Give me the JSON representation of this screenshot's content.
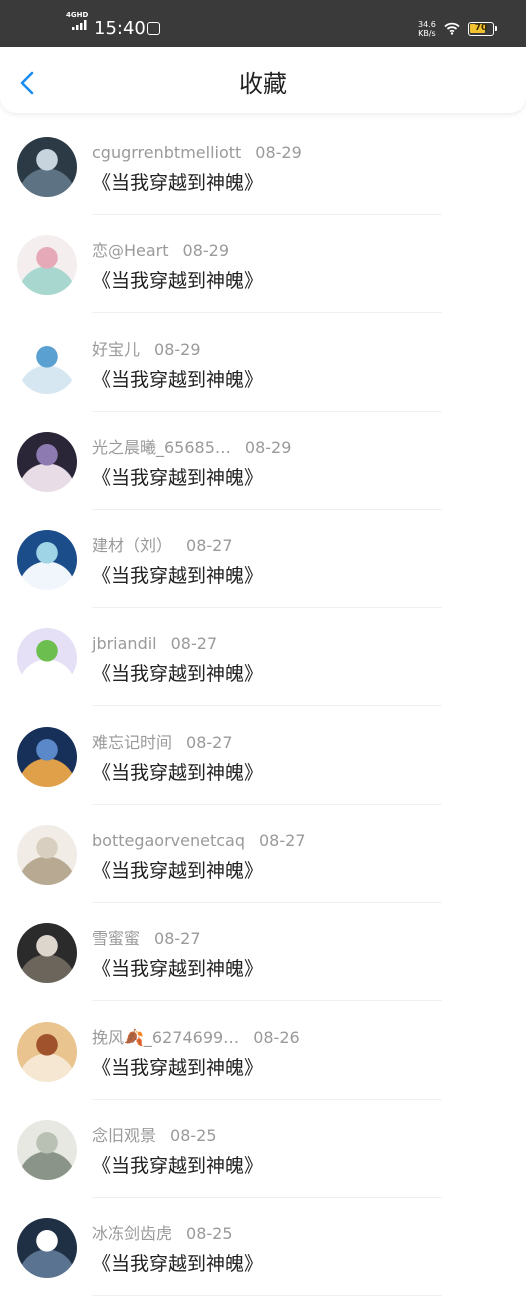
{
  "status_bar": {
    "network": "4GHD",
    "time": "15:40",
    "speed_value": "34.6",
    "speed_unit": "KB/s",
    "battery_level": 70,
    "battery_text": "70",
    "icons": [
      "signal-icon",
      "app-notification-icon",
      "wifi-icon",
      "battery-icon"
    ]
  },
  "header": {
    "back_icon": "chevron-left-icon",
    "title": "收藏"
  },
  "colors": {
    "accent": "#1a8cf0",
    "status_bar_bg": "#3a3a3a",
    "battery": "#f2c230"
  },
  "items": [
    {
      "username": "cgugrrenbtmelliott",
      "date": "08-29",
      "title": "《当我穿越到神魄》",
      "avatar_colors": [
        "#2b3a44",
        "#c7d3dd",
        "#5d7282"
      ]
    },
    {
      "username": "恋@Heart",
      "date": "08-29",
      "title": "《当我穿越到神魄》",
      "avatar_colors": [
        "#f4eeee",
        "#e6a9b8",
        "#a8d7d0"
      ]
    },
    {
      "username": "好宝儿",
      "date": "08-29",
      "title": "《当我穿越到神魄》",
      "avatar_colors": [
        "#ffffff",
        "#5aa0d0",
        "#d7e7f2"
      ]
    },
    {
      "username": "光之晨曦_65685…",
      "date": "08-29",
      "title": "《当我穿越到神魄》",
      "avatar_colors": [
        "#2a2638",
        "#8c7ab0",
        "#e8dde6"
      ]
    },
    {
      "username": "建材（刘）",
      "date": "08-27",
      "title": "《当我穿越到神魄》",
      "avatar_colors": [
        "#1b4d8a",
        "#9fd3e6",
        "#f0f6fb"
      ]
    },
    {
      "username": "jbriandil",
      "date": "08-27",
      "title": "《当我穿越到神魄》",
      "avatar_colors": [
        "#e6e0f7",
        "#6cbf4f",
        "#ffffff"
      ]
    },
    {
      "username": "难忘记时间",
      "date": "08-27",
      "title": "《当我穿越到神魄》",
      "avatar_colors": [
        "#17305a",
        "#5a88c8",
        "#e0a04a"
      ]
    },
    {
      "username": "bottegaorvenetcaq",
      "date": "08-27",
      "title": "《当我穿越到神魄》",
      "avatar_colors": [
        "#f1ede6",
        "#d9cfc0",
        "#b8a992"
      ]
    },
    {
      "username": "雪蜜蜜",
      "date": "08-27",
      "title": "《当我穿越到神魄》",
      "avatar_colors": [
        "#2b2b2b",
        "#dcd6cc",
        "#6b655c"
      ]
    },
    {
      "username": "挽风🍂_6274699…",
      "date": "08-26",
      "title": "《当我穿越到神魄》",
      "avatar_colors": [
        "#e9c48e",
        "#a0522d",
        "#f6e7d2"
      ]
    },
    {
      "username": "念旧观景",
      "date": "08-25",
      "title": "《当我穿越到神魄》",
      "avatar_colors": [
        "#e7e8e2",
        "#b9c1b5",
        "#8b9488"
      ]
    },
    {
      "username": "冰冻剑齿虎",
      "date": "08-25",
      "title": "《当我穿越到神魄》",
      "avatar_colors": [
        "#1f2f44",
        "#ffffff",
        "#5a7390"
      ]
    }
  ]
}
